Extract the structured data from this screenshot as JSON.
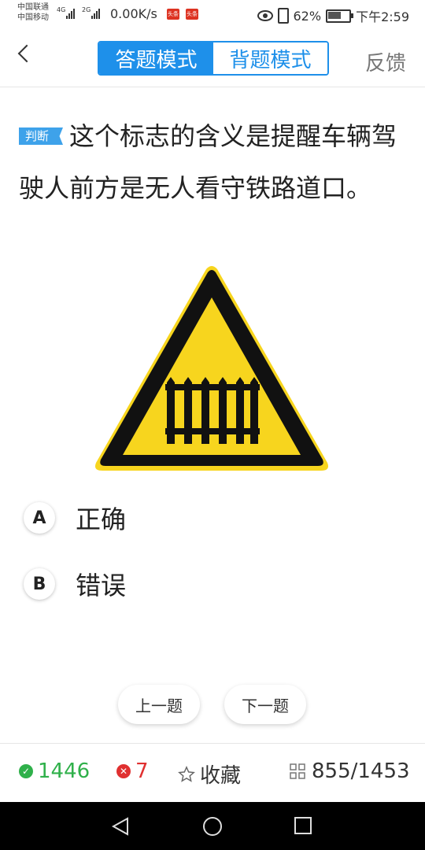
{
  "status_bar": {
    "carrier1": "中国联通",
    "carrier2": "中国移动",
    "net1": "4G",
    "net2": "2G",
    "speed": "0.00K/s",
    "notif1": "头条",
    "notif2": "头条",
    "battery": "62%",
    "battery_level": 0.62,
    "time": "下午2:59"
  },
  "header": {
    "tabs": [
      "答题模式",
      "背题模式"
    ],
    "active_tab": "答题模式",
    "feedback": "反馈"
  },
  "question": {
    "type_tag": "判断",
    "text": "这个标志的含义是提醒车辆驾驶人前方是无人看守铁路道口。"
  },
  "options": [
    {
      "letter": "A",
      "text": "正确"
    },
    {
      "letter": "B",
      "text": "错误"
    }
  ],
  "nav": {
    "prev": "上一题",
    "next": "下一题"
  },
  "bottom": {
    "correct": "1446",
    "wrong": "7",
    "favorite": "收藏",
    "progress": "855/1453"
  },
  "colors": {
    "accent": "#1e90ea",
    "correct": "#2fb04a",
    "wrong": "#e03030",
    "sign_yellow": "#f7d51e"
  },
  "icons": [
    "back-chevron-icon",
    "check-circle-icon",
    "x-circle-icon",
    "star-icon",
    "grid-icon",
    "nav-back-icon",
    "nav-home-icon",
    "nav-recents-icon"
  ]
}
